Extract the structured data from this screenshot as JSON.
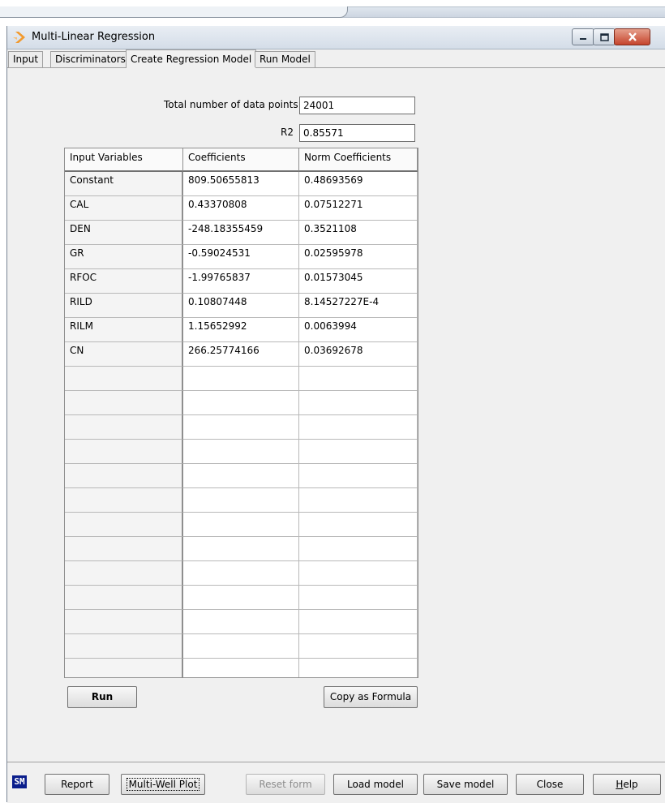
{
  "window": {
    "title": "Multi-Linear Regression"
  },
  "tabs": [
    {
      "label": "Input",
      "active": false
    },
    {
      "label": "Discriminators",
      "active": false
    },
    {
      "label": "Create Regression Model",
      "active": true
    },
    {
      "label": "Run Model",
      "active": false
    }
  ],
  "form": {
    "total_points_label": "Total number of data points",
    "total_points_value": "24001",
    "r2_label": "R2",
    "r2_value": "0.85571"
  },
  "table": {
    "headers": [
      "Input Variables",
      "Coefficients",
      "Norm Coefficients"
    ],
    "rows": [
      [
        "Constant",
        "809.50655813",
        "0.48693569"
      ],
      [
        "CAL",
        "0.43370808",
        "0.07512271"
      ],
      [
        "DEN",
        "-248.18355459",
        "0.3521108"
      ],
      [
        "GR",
        "-0.59024531",
        "0.02595978"
      ],
      [
        "RFOC",
        "-1.99765837",
        "0.01573045"
      ],
      [
        "RILD",
        "0.10807448",
        "8.14527227E-4"
      ],
      [
        "RILM",
        "1.15652992",
        "0.0063994"
      ],
      [
        "CN",
        "266.25774166",
        "0.03692678"
      ],
      [
        "",
        "",
        ""
      ],
      [
        "",
        "",
        ""
      ],
      [
        "",
        "",
        ""
      ],
      [
        "",
        "",
        ""
      ],
      [
        "",
        "",
        ""
      ],
      [
        "",
        "",
        ""
      ],
      [
        "",
        "",
        ""
      ],
      [
        "",
        "",
        ""
      ],
      [
        "",
        "",
        ""
      ],
      [
        "",
        "",
        ""
      ],
      [
        "",
        "",
        ""
      ],
      [
        "",
        "",
        ""
      ],
      [
        "",
        "",
        ""
      ],
      [
        "",
        "",
        ""
      ]
    ]
  },
  "actions": {
    "run": "Run",
    "copy_formula": "Copy as Formula"
  },
  "bottom": {
    "logo": "SM",
    "report": "Report",
    "multi_well_plot": "Multi-Well Plot",
    "reset_form": "Reset form",
    "load_model": "Load model",
    "save_model": "Save model",
    "close": "Close",
    "help_prefix": "H",
    "help_rest": "elp"
  },
  "colors": {
    "logo_bg": "#0a1e8c",
    "icon_accent": "#f29a2e",
    "close_button": "#c5442c"
  },
  "icons": {
    "app": "orange-chevron",
    "minimize": "minimize-icon",
    "maximize": "maximize-icon",
    "close": "close-icon"
  }
}
